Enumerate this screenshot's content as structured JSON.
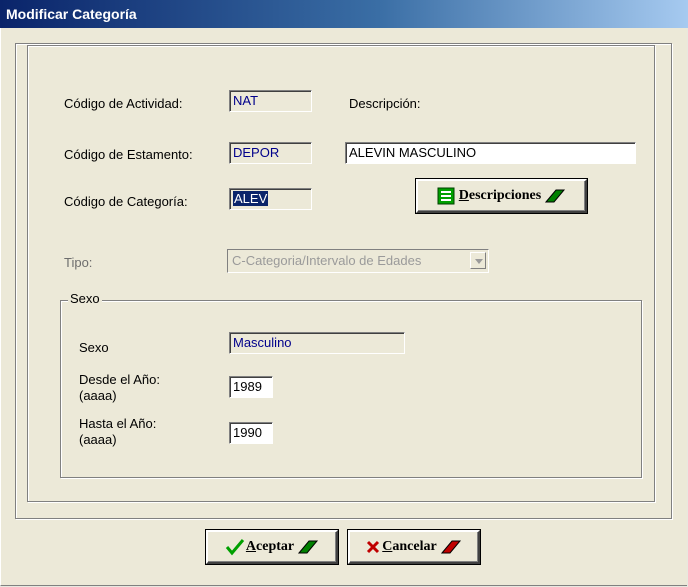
{
  "window": {
    "title": "Modificar Categoría"
  },
  "fields": {
    "codigo_actividad": {
      "label": "Código de Actividad:",
      "value": "NAT"
    },
    "descripcion": {
      "label": "Descripción:",
      "value": "ALEVIN MASCULINO"
    },
    "codigo_estamento": {
      "label": "Código de Estamento:",
      "value": "DEPOR"
    },
    "codigo_categoria": {
      "label": "Código de Categoría:",
      "value": "ALEV"
    },
    "tipo": {
      "label": "Tipo:",
      "value": "C-Categoria/Intervalo de Edades"
    }
  },
  "buttons": {
    "descripciones": {
      "label_first": "D",
      "label_rest": "escripciones"
    },
    "aceptar": {
      "label_first": "A",
      "label_rest": "ceptar"
    },
    "cancelar": {
      "label_first": "C",
      "label_rest": "ancelar"
    }
  },
  "sexo_group": {
    "title": "Sexo",
    "sexo": {
      "label": "Sexo",
      "value": "Masculino"
    },
    "desde": {
      "label_line1": "Desde el Año:",
      "label_line2": "(aaaa)",
      "value": "1989"
    },
    "hasta": {
      "label_line1": "Hasta el Año:",
      "label_line2": "(aaaa)",
      "value": "1990"
    }
  },
  "colors": {
    "accent_green": "#008000",
    "cancel_red": "#c00000",
    "title_blue": "#0a246a"
  }
}
